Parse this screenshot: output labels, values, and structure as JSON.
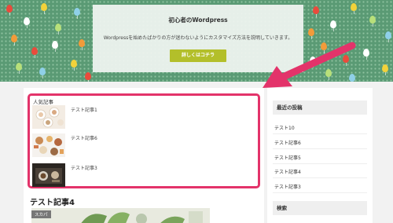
{
  "hero": {
    "title": "初心者のWordpress",
    "description": "Wordpressを始めたばかりの方が迷わないようにカスタマイズ方法を説明していきます。",
    "button_label": "詳しくはコチラ",
    "background_color": "#5a9a74",
    "button_color": "#b3bf2a"
  },
  "popular": {
    "heading": "人気記事",
    "highlight_color": "#e3336a",
    "items": [
      {
        "title": "テスト記事1"
      },
      {
        "title": "テスト記事6"
      },
      {
        "title": "テスト記事3"
      }
    ]
  },
  "article": {
    "title": "テスト記事4",
    "category": "スカパ"
  },
  "sidebar": {
    "recent_heading": "最近の投稿",
    "recent_items": [
      "テスト10",
      "テスト記事6",
      "テスト記事5",
      "テスト記事4",
      "テスト記事3"
    ],
    "search_heading": "検索"
  }
}
